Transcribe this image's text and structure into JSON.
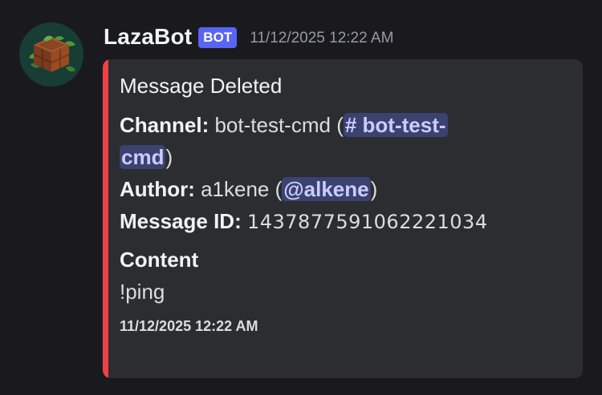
{
  "author": {
    "name": "LazaBot",
    "tag": "BOT",
    "timestamp": "11/12/2025 12:22 AM",
    "avatar_icon": "crate-with-leaves-icon"
  },
  "embed": {
    "accent_color": "#ed4245",
    "title": "Message Deleted",
    "channel": {
      "label": "Channel:",
      "name": "bot-test-cmd",
      "open_paren": " (",
      "mention_line1": "# bot-test-",
      "mention_line2": "cmd",
      "close_paren": ")"
    },
    "author_field": {
      "label": "Author:",
      "name": "a1kene",
      "open_paren": " (",
      "mention": "@alkene",
      "close_paren": ")"
    },
    "message_id": {
      "label": "Message ID:",
      "value": "1437877591062221034"
    },
    "content_field": {
      "name": "Content",
      "value": "!ping"
    },
    "footer": "11/12/2025 12:22 AM"
  }
}
